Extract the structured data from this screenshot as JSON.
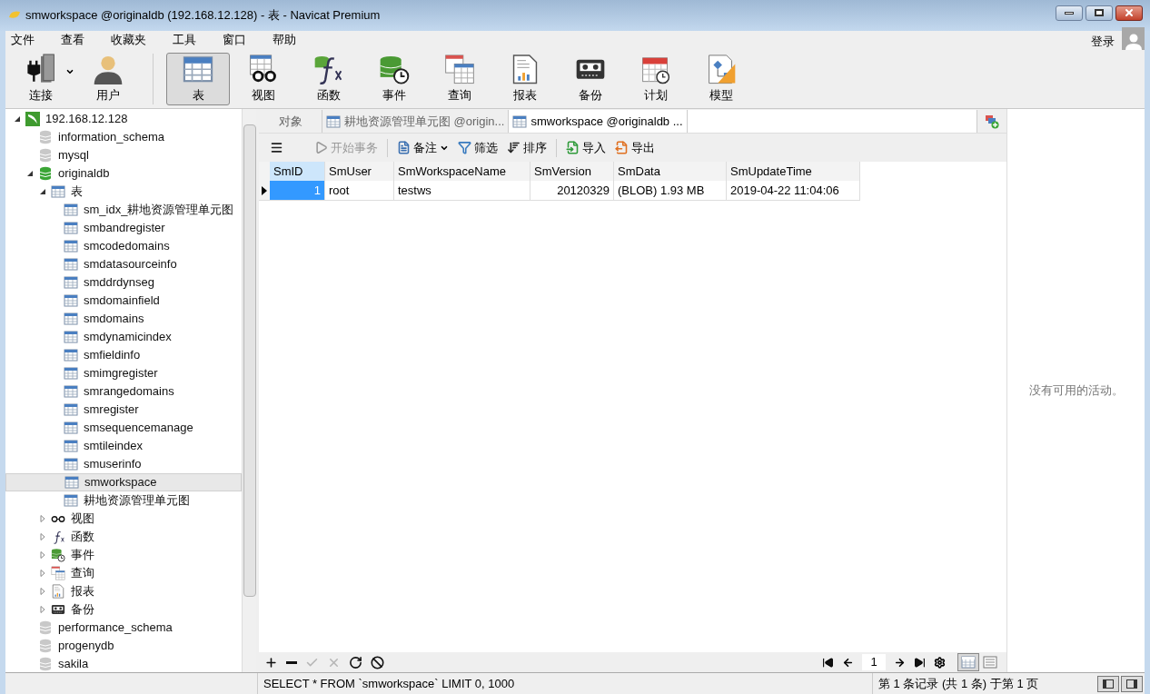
{
  "window": {
    "title": "smworkspace @originaldb (192.168.12.128) - 表 - Navicat Premium"
  },
  "menu": [
    "文件",
    "查看",
    "收藏夹",
    "工具",
    "窗口",
    "帮助"
  ],
  "login": "登录",
  "toolbar": [
    {
      "kind": "connect",
      "label": "连接",
      "selected": false
    },
    {
      "kind": "user",
      "label": "用户",
      "selected": false
    },
    {
      "kind": "table",
      "label": "表",
      "selected": true
    },
    {
      "kind": "view",
      "label": "视图",
      "selected": false
    },
    {
      "kind": "function",
      "label": "函数",
      "selected": false
    },
    {
      "kind": "event",
      "label": "事件",
      "selected": false
    },
    {
      "kind": "query",
      "label": "查询",
      "selected": false
    },
    {
      "kind": "report",
      "label": "报表",
      "selected": false
    },
    {
      "kind": "backup",
      "label": "备份",
      "selected": false
    },
    {
      "kind": "schedule",
      "label": "计划",
      "selected": false
    },
    {
      "kind": "model",
      "label": "模型",
      "selected": false
    }
  ],
  "tree": [
    {
      "kind": "server",
      "label": "192.168.12.128",
      "expanded": true,
      "selected": false,
      "children": [
        {
          "kind": "db",
          "label": "information_schema",
          "open": false,
          "selected": false
        },
        {
          "kind": "db",
          "label": "mysql",
          "open": false,
          "selected": false
        },
        {
          "kind": "db",
          "label": "originaldb",
          "open": true,
          "expanded": true,
          "selected": false,
          "children": [
            {
              "kind": "table",
              "label": "表",
              "expanded": true,
              "selected": false,
              "children": [
                {
                  "kind": "table",
                  "label": "sm_idx_耕地资源管理单元图",
                  "selected": false
                },
                {
                  "kind": "table",
                  "label": "smbandregister",
                  "selected": false
                },
                {
                  "kind": "table",
                  "label": "smcodedomains",
                  "selected": false
                },
                {
                  "kind": "table",
                  "label": "smdatasourceinfo",
                  "selected": false
                },
                {
                  "kind": "table",
                  "label": "smddrdynseg",
                  "selected": false
                },
                {
                  "kind": "table",
                  "label": "smdomainfield",
                  "selected": false
                },
                {
                  "kind": "table",
                  "label": "smdomains",
                  "selected": false
                },
                {
                  "kind": "table",
                  "label": "smdynamicindex",
                  "selected": false
                },
                {
                  "kind": "table",
                  "label": "smfieldinfo",
                  "selected": false
                },
                {
                  "kind": "table",
                  "label": "smimgregister",
                  "selected": false
                },
                {
                  "kind": "table",
                  "label": "smrangedomains",
                  "selected": false
                },
                {
                  "kind": "table",
                  "label": "smregister",
                  "selected": false
                },
                {
                  "kind": "table",
                  "label": "smsequencemanage",
                  "selected": false
                },
                {
                  "kind": "table",
                  "label": "smtileindex",
                  "selected": false
                },
                {
                  "kind": "table",
                  "label": "smuserinfo",
                  "selected": false
                },
                {
                  "kind": "table",
                  "label": "smworkspace",
                  "selected": true
                },
                {
                  "kind": "table",
                  "label": "耕地资源管理单元图",
                  "selected": false
                }
              ]
            },
            {
              "kind": "view",
              "label": "视图",
              "expanded": false,
              "selected": false
            },
            {
              "kind": "function",
              "label": "函数",
              "expanded": false,
              "selected": false
            },
            {
              "kind": "event",
              "label": "事件",
              "expanded": false,
              "selected": false
            },
            {
              "kind": "query",
              "label": "查询",
              "expanded": false,
              "selected": false
            },
            {
              "kind": "report",
              "label": "报表",
              "expanded": false,
              "selected": false
            },
            {
              "kind": "backup",
              "label": "备份",
              "expanded": false,
              "selected": false
            }
          ]
        },
        {
          "kind": "db",
          "label": "performance_schema",
          "open": false,
          "selected": false
        },
        {
          "kind": "db",
          "label": "progenydb",
          "open": false,
          "selected": false
        },
        {
          "kind": "db",
          "label": "sakila",
          "open": false,
          "selected": false
        }
      ]
    }
  ],
  "tabs": [
    {
      "kind": "objects",
      "label": "对象",
      "selected": false
    },
    {
      "kind": "table",
      "label": "耕地资源管理单元图 @origin...",
      "selected": false
    },
    {
      "kind": "table",
      "label": "smworkspace @originaldb ...",
      "selected": true
    }
  ],
  "grid_toolbar": [
    {
      "kind": "menu"
    },
    {
      "kind": "transaction",
      "label": "开始事务",
      "disabled": true
    },
    {
      "kind": "memo",
      "label": "备注",
      "disabled": false
    },
    {
      "kind": "filter",
      "label": "筛选",
      "disabled": false
    },
    {
      "kind": "sort",
      "label": "排序",
      "disabled": false
    },
    {
      "kind": "import",
      "label": "导入",
      "disabled": false
    },
    {
      "kind": "export",
      "label": "导出",
      "disabled": false
    }
  ],
  "table": {
    "columns": [
      {
        "label": "SmID",
        "selected": true,
        "kind": "number"
      },
      {
        "label": "SmUser",
        "selected": false,
        "kind": "text"
      },
      {
        "label": "SmWorkspaceName",
        "selected": false,
        "kind": "text"
      },
      {
        "label": "SmVersion",
        "selected": false,
        "kind": "number"
      },
      {
        "label": "SmData",
        "selected": false,
        "kind": "text"
      },
      {
        "label": "SmUpdateTime",
        "selected": false,
        "kind": "text"
      }
    ],
    "rows": [
      {
        "current": true,
        "cells": [
          {
            "text": "1",
            "selected": true
          },
          {
            "text": "root",
            "selected": false
          },
          {
            "text": "testws",
            "selected": false
          },
          {
            "text": "20120329",
            "selected": false
          },
          {
            "text": "(BLOB) 1.93 MB",
            "selected": false
          },
          {
            "text": "2019-04-22 11:04:06",
            "selected": false
          }
        ]
      }
    ]
  },
  "record_buttons": [
    {
      "kind": "add",
      "disabled": false
    },
    {
      "kind": "delete",
      "disabled": false
    },
    {
      "kind": "apply",
      "disabled": true
    },
    {
      "kind": "cancel",
      "disabled": true
    },
    {
      "kind": "refresh",
      "disabled": false
    },
    {
      "kind": "stop",
      "disabled": false
    }
  ],
  "pager": {
    "page": "1"
  },
  "view_modes": [
    {
      "kind": "grid",
      "selected": true
    },
    {
      "kind": "form",
      "selected": false
    }
  ],
  "activity": "没有可用的活动。",
  "status_bar": {
    "sql": "SELECT * FROM `smworkspace` LIMIT 0, 1000",
    "records": "第 1 条记录 (共 1 条) 于第 1 页"
  }
}
